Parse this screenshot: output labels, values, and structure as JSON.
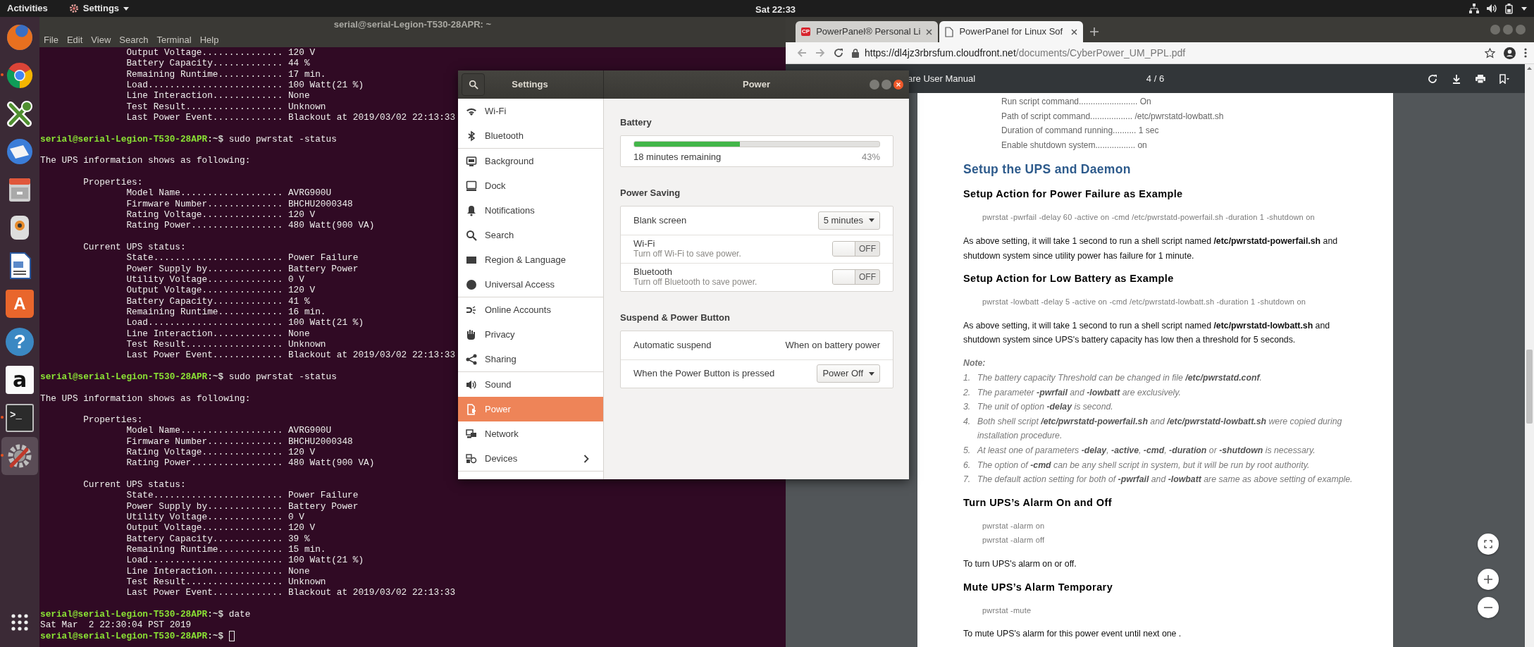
{
  "top_bar": {
    "activities": "Activities",
    "app_menu": "Settings",
    "clock": "Sat 22:33"
  },
  "dock": {
    "items": [
      {
        "kind": "globe",
        "running": false,
        "selected": false
      },
      {
        "kind": "wheel",
        "running": true,
        "selected": false
      },
      {
        "kind": "key",
        "running": false,
        "selected": false
      },
      {
        "kind": "mail",
        "running": false,
        "selected": false
      },
      {
        "kind": "cabinet",
        "running": false,
        "selected": false
      },
      {
        "kind": "speaker",
        "running": false,
        "selected": false
      },
      {
        "kind": "document",
        "running": false,
        "selected": false
      },
      {
        "kind": "bag",
        "glyph": "A",
        "running": false,
        "selected": false
      },
      {
        "kind": "help",
        "glyph": "?",
        "running": false,
        "selected": false
      },
      {
        "kind": "letter",
        "glyph": "a",
        "running": false,
        "selected": false
      },
      {
        "kind": "terminal",
        "glyph": ">_",
        "running": true,
        "selected": false
      },
      {
        "kind": "tools",
        "running": true,
        "selected": true
      }
    ]
  },
  "terminal": {
    "title": "serial@serial-Legion-T530-28APR: ~",
    "menu": [
      "File",
      "Edit",
      "View",
      "Search",
      "Terminal",
      "Help"
    ],
    "lines": [
      {
        "kind": "field",
        "label": "Output Voltage...............",
        "value": "120 V"
      },
      {
        "kind": "field",
        "label": "Battery Capacity.............",
        "value": "44 %"
      },
      {
        "kind": "field",
        "label": "Remaining Runtime............",
        "value": "17 min."
      },
      {
        "kind": "field",
        "label": "Load.........................",
        "value": "100 Watt(21 %)"
      },
      {
        "kind": "field",
        "label": "Line Interaction.............",
        "value": "None"
      },
      {
        "kind": "field",
        "label": "Test Result..................",
        "value": "Unknown"
      },
      {
        "kind": "field",
        "label": "Last Power Event.............",
        "value": "Blackout at 2019/03/02 22:13:33"
      },
      {
        "kind": "blank"
      },
      {
        "kind": "prompt",
        "user": "serial@serial-Legion-T530-28APR",
        "path": ":~$",
        "command": "sudo pwrstat -status",
        "cursor": false
      },
      {
        "kind": "blank"
      },
      {
        "kind": "text",
        "text": "The UPS information shows as following:"
      },
      {
        "kind": "blank"
      },
      {
        "kind": "section",
        "text": "Properties:"
      },
      {
        "kind": "field",
        "label": "Model Name...................",
        "value": "AVRG900U"
      },
      {
        "kind": "field",
        "label": "Firmware Number..............",
        "value": "BHCHU2000348"
      },
      {
        "kind": "field",
        "label": "Rating Voltage...............",
        "value": "120 V"
      },
      {
        "kind": "field",
        "label": "Rating Power.................",
        "value": "480 Watt(900 VA)"
      },
      {
        "kind": "blank"
      },
      {
        "kind": "section",
        "text": "Current UPS status:"
      },
      {
        "kind": "field",
        "label": "State........................",
        "value": "Power Failure"
      },
      {
        "kind": "field",
        "label": "Power Supply by..............",
        "value": "Battery Power"
      },
      {
        "kind": "field",
        "label": "Utility Voltage..............",
        "value": "0 V"
      },
      {
        "kind": "field",
        "label": "Output Voltage...............",
        "value": "120 V"
      },
      {
        "kind": "field",
        "label": "Battery Capacity.............",
        "value": "41 %"
      },
      {
        "kind": "field",
        "label": "Remaining Runtime............",
        "value": "16 min."
      },
      {
        "kind": "field",
        "label": "Load.........................",
        "value": "100 Watt(21 %)"
      },
      {
        "kind": "field",
        "label": "Line Interaction.............",
        "value": "None"
      },
      {
        "kind": "field",
        "label": "Test Result..................",
        "value": "Unknown"
      },
      {
        "kind": "field",
        "label": "Last Power Event.............",
        "value": "Blackout at 2019/03/02 22:13:33"
      },
      {
        "kind": "blank"
      },
      {
        "kind": "prompt",
        "user": "serial@serial-Legion-T530-28APR",
        "path": ":~$",
        "command": "sudo pwrstat -status",
        "cursor": false
      },
      {
        "kind": "blank"
      },
      {
        "kind": "text",
        "text": "The UPS information shows as following:"
      },
      {
        "kind": "blank"
      },
      {
        "kind": "section",
        "text": "Properties:"
      },
      {
        "kind": "field",
        "label": "Model Name...................",
        "value": "AVRG900U"
      },
      {
        "kind": "field",
        "label": "Firmware Number..............",
        "value": "BHCHU2000348"
      },
      {
        "kind": "field",
        "label": "Rating Voltage...............",
        "value": "120 V"
      },
      {
        "kind": "field",
        "label": "Rating Power.................",
        "value": "480 Watt(900 VA)"
      },
      {
        "kind": "blank"
      },
      {
        "kind": "section",
        "text": "Current UPS status:"
      },
      {
        "kind": "field",
        "label": "State........................",
        "value": "Power Failure"
      },
      {
        "kind": "field",
        "label": "Power Supply by..............",
        "value": "Battery Power"
      },
      {
        "kind": "field",
        "label": "Utility Voltage..............",
        "value": "0 V"
      },
      {
        "kind": "field",
        "label": "Output Voltage...............",
        "value": "120 V"
      },
      {
        "kind": "field",
        "label": "Battery Capacity.............",
        "value": "39 %"
      },
      {
        "kind": "field",
        "label": "Remaining Runtime............",
        "value": "15 min."
      },
      {
        "kind": "field",
        "label": "Load.........................",
        "value": "100 Watt(21 %)"
      },
      {
        "kind": "field",
        "label": "Line Interaction.............",
        "value": "None"
      },
      {
        "kind": "field",
        "label": "Test Result..................",
        "value": "Unknown"
      },
      {
        "kind": "field",
        "label": "Last Power Event.............",
        "value": "Blackout at 2019/03/02 22:13:33"
      },
      {
        "kind": "blank"
      },
      {
        "kind": "prompt",
        "user": "serial@serial-Legion-T530-28APR",
        "path": ":~$",
        "command": "date",
        "cursor": false
      },
      {
        "kind": "text",
        "text": "Sat Mar  2 22:30:04 PST 2019"
      },
      {
        "kind": "prompt",
        "user": "serial@serial-Legion-T530-28APR",
        "path": ":~$",
        "cursor": true
      }
    ]
  },
  "settings": {
    "sidebar_title": "Settings",
    "panel_title": "Power",
    "sidebar_groups": [
      {
        "items": [
          {
            "label": "Wi-Fi",
            "selected": false,
            "submenu": false
          },
          {
            "label": "Bluetooth",
            "selected": false,
            "submenu": false
          }
        ]
      },
      {
        "items": [
          {
            "label": "Background",
            "selected": false,
            "submenu": false
          },
          {
            "label": "Dock",
            "selected": false,
            "submenu": false
          },
          {
            "label": "Notifications",
            "selected": false,
            "submenu": false
          },
          {
            "label": "Search",
            "selected": false,
            "submenu": false
          },
          {
            "label": "Region & Language",
            "selected": false,
            "submenu": false
          },
          {
            "label": "Universal Access",
            "selected": false,
            "submenu": false
          }
        ]
      },
      {
        "items": [
          {
            "label": "Online Accounts",
            "selected": false,
            "submenu": false
          },
          {
            "label": "Privacy",
            "selected": false,
            "submenu": false
          },
          {
            "label": "Sharing",
            "selected": false,
            "submenu": false
          }
        ]
      },
      {
        "items": [
          {
            "label": "Sound",
            "selected": false,
            "submenu": false
          },
          {
            "label": "Power",
            "selected": true,
            "submenu": false
          },
          {
            "label": "Network",
            "selected": false,
            "submenu": false
          },
          {
            "label": "Devices",
            "selected": false,
            "submenu": true
          }
        ]
      }
    ],
    "sections": [
      {
        "kind": "battery",
        "heading": "Battery",
        "level": 0.43,
        "remaining": "18 minutes remaining",
        "percent": "43%"
      },
      {
        "kind": "rows",
        "heading": "Power Saving",
        "rows": [
          {
            "kind": "dropdown",
            "label": "Blank screen",
            "value": "5 minutes"
          },
          {
            "kind": "switch",
            "label": "Wi-Fi",
            "description": "Turn off Wi-Fi to save power.",
            "on": false,
            "state": "OFF"
          },
          {
            "kind": "switch",
            "label": "Bluetooth",
            "description": "Turn off Bluetooth to save power.",
            "on": false,
            "state": "OFF"
          }
        ]
      },
      {
        "kind": "rows",
        "heading": "Suspend & Power Button",
        "rows": [
          {
            "kind": "value",
            "label": "Automatic suspend",
            "value": "When on battery power"
          },
          {
            "kind": "dropdown",
            "label": "When the Power Button is pressed",
            "value": "Power Off"
          }
        ]
      }
    ]
  },
  "browser": {
    "tabs": [
      {
        "label": "PowerPanel® Personal Li",
        "favicon_text": "CP",
        "selected": false
      },
      {
        "label": "PowerPanel for Linux Sof",
        "selected": true
      }
    ],
    "url_host": "https://dl4jz3rbrsfum.cloudfront.net",
    "url_path": "/documents/CyberPower_UM_PPL.pdf",
    "pdf_title": "are User Manual",
    "page": "4 / 6",
    "document": {
      "blocks": [
        {
          "kind": "setting",
          "text": "Run script command......................... On"
        },
        {
          "kind": "setting",
          "text": "Path of script command.................. /etc/pwrstatd-lowbatt.sh"
        },
        {
          "kind": "setting",
          "text": "Duration of command running.......... 1 sec"
        },
        {
          "kind": "setting",
          "text": "Enable shutdown system................. on"
        },
        {
          "kind": "h1",
          "text": "Setup the UPS and Daemon"
        },
        {
          "kind": "h2",
          "text": "Setup Action for Power Failure as Example"
        },
        {
          "kind": "code",
          "lines": [
            "pwrstat -pwrfail -delay 60 -active on -cmd /etc/pwrstatd-powerfail.sh -duration 1 -shutdown on"
          ]
        },
        {
          "kind": "para",
          "text": "As above setting, it will take 1 second to run a shell script named **/etc/pwrstatd-powerfail.sh** and shutdown system since utility power has failure for 1 minute."
        },
        {
          "kind": "h2",
          "text": "Setup Action for Low Battery as Example"
        },
        {
          "kind": "code",
          "lines": [
            "pwrstat -lowbatt -delay 5 -active on -cmd /etc/pwrstatd-lowbatt.sh -duration 1 -shutdown on"
          ]
        },
        {
          "kind": "para",
          "text": "As above setting, it will take 1 second to run a shell script named **/etc/pwrstatd-lowbatt.sh** and shutdown system since UPS's battery capacity has low then a threshold for 5 seconds."
        },
        {
          "kind": "note",
          "text": "Note:"
        },
        {
          "kind": "list",
          "items": [
            {
              "number": "1.",
              "text": "The battery capacity Threshold can be changed in file **/etc/pwrstatd.conf**."
            },
            {
              "number": "2.",
              "text": "The parameter **-pwrfail** and **-lowbatt** are exclusively."
            },
            {
              "number": "3.",
              "text": "The unit of option **-delay** is second."
            },
            {
              "number": "4.",
              "text": "Both shell script **/etc/pwrstatd-powerfail.sh** and **/etc/pwrstatd-lowbatt.sh** were copied during installation procedure."
            },
            {
              "number": "5.",
              "text": "At least one of parameters **-delay**, **-active**, **-cmd**, **-duration** or **-shutdown** is necessary."
            },
            {
              "number": "6.",
              "text": "The option of **-cmd** can be any shell script in system, but it will be run by root authority."
            },
            {
              "number": "7.",
              "text": "The default action setting for both of **-pwrfail** and **-lowbatt** are same as above setting of example."
            }
          ]
        },
        {
          "kind": "h2",
          "text": "Turn UPS’s Alarm On and Off"
        },
        {
          "kind": "code",
          "lines": [
            "pwrstat -alarm on",
            "pwrstat -alarm off"
          ]
        },
        {
          "kind": "para",
          "text": "To turn UPS's alarm on or off."
        },
        {
          "kind": "h2",
          "text": "Mute UPS’s Alarm Temporary"
        },
        {
          "kind": "code",
          "lines": [
            "pwrstat -mute"
          ]
        },
        {
          "kind": "para",
          "text": "To mute UPS's alarm for this power event until next one ."
        }
      ]
    }
  }
}
